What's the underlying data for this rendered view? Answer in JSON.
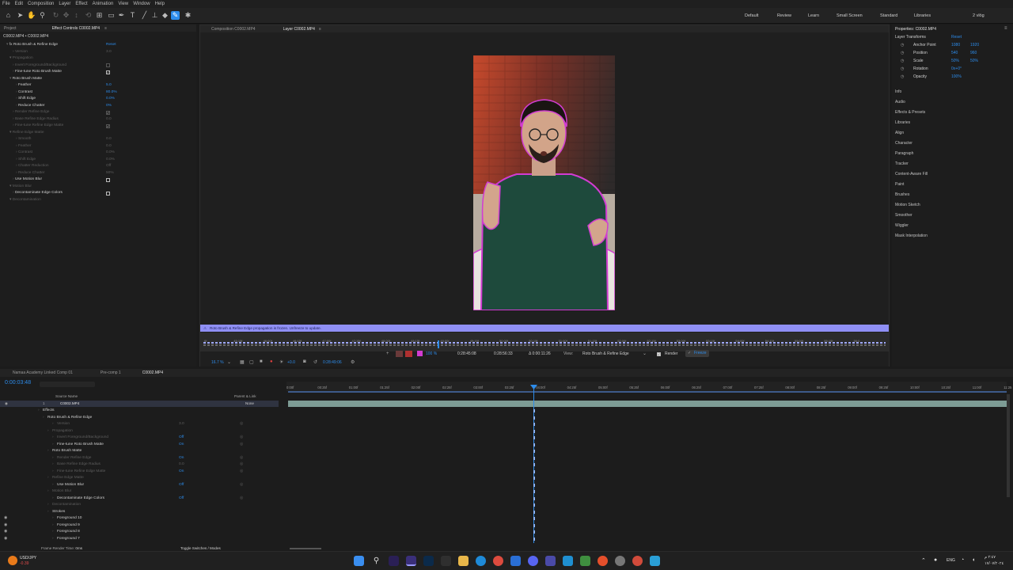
{
  "menu": [
    "File",
    "Edit",
    "Composition",
    "Layer",
    "Effect",
    "Animation",
    "View",
    "Window",
    "Help"
  ],
  "workspaces": [
    "Default",
    "Review",
    "Learn",
    "Small Screen",
    "Standard",
    "Libraries"
  ],
  "workspaces_extra": "2 vlög",
  "effect_panel": {
    "tabs": [
      "Project",
      "Effect Controls C0002.MP4"
    ],
    "header": "C0002.MP4 • C0002.MP4",
    "rows": [
      {
        "label": "fx  Roto Brush & Refine Edge",
        "value": "Reset",
        "indent": 1,
        "style": "wht",
        "vstyle": "blue"
      },
      {
        "label": "Version",
        "value": "3.0",
        "indent": 3,
        "style": "dim",
        "vstyle": "dim"
      },
      {
        "label": "Propagation",
        "value": "",
        "indent": 2,
        "style": "dim"
      },
      {
        "label": "Invert Foreground/Background",
        "value": "",
        "indent": 3,
        "style": "dim",
        "check": "off-dis"
      },
      {
        "label": "Fine-tune Roto Brush Matte",
        "value": "",
        "indent": 3,
        "style": "wht",
        "check": "on"
      },
      {
        "label": "Roto Brush Matte",
        "value": "",
        "indent": 2,
        "style": "wht"
      },
      {
        "label": "Feather",
        "value": "5.0",
        "indent": 4,
        "style": "wht",
        "vstyle": "blue"
      },
      {
        "label": "Contrast",
        "value": "80.0%",
        "indent": 4,
        "style": "wht",
        "vstyle": "blue"
      },
      {
        "label": "Shift Edge",
        "value": "0.0%",
        "indent": 4,
        "style": "wht",
        "vstyle": "blue"
      },
      {
        "label": "Reduce Chatter",
        "value": "0%",
        "indent": 4,
        "style": "wht",
        "vstyle": "blue"
      },
      {
        "label": "Render Refine Edge",
        "value": "",
        "indent": 3,
        "style": "dim",
        "check": "on-dis"
      },
      {
        "label": "Base Refine Edge Radius",
        "value": "0.0",
        "indent": 3,
        "style": "dim",
        "vstyle": "dim"
      },
      {
        "label": "Fine-tune Refine Edge Matte",
        "value": "",
        "indent": 3,
        "style": "dim",
        "check": "on-dis"
      },
      {
        "label": "Refine Edge Matte",
        "value": "",
        "indent": 2,
        "style": "dim"
      },
      {
        "label": "Smooth",
        "value": "0.0",
        "indent": 4,
        "style": "dim",
        "vstyle": "dim"
      },
      {
        "label": "Feather",
        "value": "0.0",
        "indent": 4,
        "style": "dim",
        "vstyle": "dim"
      },
      {
        "label": "Contrast",
        "value": "0.0%",
        "indent": 4,
        "style": "dim",
        "vstyle": "dim"
      },
      {
        "label": "Shift Edge",
        "value": "0.0%",
        "indent": 4,
        "style": "dim",
        "vstyle": "dim"
      },
      {
        "label": "Chatter Reduction",
        "value": "Off",
        "indent": 4,
        "style": "dim",
        "vstyle": "dim"
      },
      {
        "label": "Reduce Chatter",
        "value": "50%",
        "indent": 4,
        "style": "dim",
        "vstyle": "dim"
      },
      {
        "label": "Use Motion Blur",
        "value": "",
        "indent": 3,
        "style": "wht",
        "check": "off"
      },
      {
        "label": "Motion Blur",
        "value": "",
        "indent": 2,
        "style": "dim"
      },
      {
        "label": "Decontaminate Edge Colors",
        "value": "",
        "indent": 3,
        "style": "wht",
        "check": "off"
      },
      {
        "label": "Decontamination",
        "value": "",
        "indent": 2,
        "style": "dim"
      }
    ]
  },
  "viewer": {
    "tabs": [
      "Composition C0002.MP4",
      "Layer C0002.MP4"
    ],
    "status_bar": "Roto Brush & Refine Edge propagation is frozen. Unfreeze to update.",
    "ruler_ticks": [
      "0f",
      "45:15f",
      "46:00f",
      "46:15f",
      "47:00f",
      "47:15f",
      "48:00f",
      "48:15f",
      "49:00f",
      "49:15f",
      "50:00f",
      "50:15f",
      "51:00f",
      "51:15f",
      "52:00f",
      "52:15f",
      "53:00f",
      "53:15f",
      "54:00f",
      "54:15f",
      "55:00f",
      "55:15f",
      "56:0"
    ],
    "zoom": "16.7 %",
    "exposure": "+0.0",
    "timecode": "0:28:49:06",
    "in_point": "0:28:45:08",
    "out_point": "0:28:56:33",
    "duration": "Δ 0:00:11:26",
    "view_label": "View:",
    "view_value": "Roto Brush & Refine Edge",
    "render_label": "Render",
    "freeze_label": "Freeze",
    "mag": "100 %"
  },
  "properties": {
    "title": "Properties: C0002.MP4",
    "section": "Layer Transforms",
    "reset": "Reset",
    "rows": [
      {
        "label": "Anchor Point",
        "v1": "1080",
        "v2": "1920"
      },
      {
        "label": "Position",
        "v1": "540",
        "v2": "960"
      },
      {
        "label": "Scale",
        "v1": "50%",
        "v2": "50%"
      },
      {
        "label": "Rotation",
        "v1": "0x+0°",
        "v2": ""
      },
      {
        "label": "Opacity",
        "v1": "100%",
        "v2": ""
      }
    ],
    "panels": [
      "Info",
      "Audio",
      "Effects & Presets",
      "Libraries",
      "Align",
      "Character",
      "Paragraph",
      "Tracker",
      "Content-Aware Fill",
      "Paint",
      "Brushes",
      "Motion Sketch",
      "Smoother",
      "Wiggler",
      "Mask Interpolation"
    ]
  },
  "timeline": {
    "tabs": [
      "Namaa Academy Linked Comp 01",
      "Pre-comp 1",
      "C0002.MP4"
    ],
    "timecode": "0:00:03:48",
    "col_source": "Source Name",
    "col_parent": "Parent & Link",
    "layer": {
      "num": "1",
      "name": "C0002.MP4",
      "parent": "None"
    },
    "rows": [
      {
        "label": "Effects",
        "indent": 1,
        "style": "wht",
        "val": ""
      },
      {
        "label": "Roto Brush & Refine Edge",
        "indent": 2,
        "style": "wht",
        "val": ""
      },
      {
        "label": "Version",
        "indent": 4,
        "style": "dim",
        "val": "3.0"
      },
      {
        "label": "Propagation",
        "indent": 3,
        "style": "dim",
        "val": ""
      },
      {
        "label": "Invert Foreground/Background",
        "indent": 4,
        "style": "dim",
        "val": "Off"
      },
      {
        "label": "Fine-tune Roto Brush Matte",
        "indent": 4,
        "style": "wht",
        "val": "On"
      },
      {
        "label": "Roto Brush Matte",
        "indent": 3,
        "style": "wht",
        "val": ""
      },
      {
        "label": "Render Refine Edge",
        "indent": 4,
        "style": "dim",
        "val": "On"
      },
      {
        "label": "Base Refine Edge Radius",
        "indent": 4,
        "style": "dim",
        "val": "0.0"
      },
      {
        "label": "Fine-tune Refine Edge Matte",
        "indent": 4,
        "style": "dim",
        "val": "On"
      },
      {
        "label": "Refine Edge Matte",
        "indent": 3,
        "style": "dim",
        "val": ""
      },
      {
        "label": "Use Motion Blur",
        "indent": 4,
        "style": "wht",
        "val": "Off"
      },
      {
        "label": "Motion Blur",
        "indent": 3,
        "style": "dim",
        "val": ""
      },
      {
        "label": "Decontaminate Edge Colors",
        "indent": 4,
        "style": "wht",
        "val": "Off"
      },
      {
        "label": "Decontamination",
        "indent": 3,
        "style": "dim",
        "val": ""
      },
      {
        "label": "Strokes",
        "indent": 3,
        "style": "wht",
        "val": ""
      },
      {
        "label": "Foreground 10",
        "indent": 4,
        "style": "wht",
        "val": ""
      },
      {
        "label": "Foreground 9",
        "indent": 4,
        "style": "wht",
        "val": ""
      },
      {
        "label": "Foreground 8",
        "indent": 4,
        "style": "wht",
        "val": ""
      },
      {
        "label": "Foreground 7",
        "indent": 4,
        "style": "wht",
        "val": ""
      }
    ],
    "ruler": [
      "0:00f",
      "00:25f",
      "01:00f",
      "01:25f",
      "02:00f",
      "02:25f",
      "03:00f",
      "03:25f",
      "04:00f",
      "04:25f",
      "05:00f",
      "05:25f",
      "06:00f",
      "06:25f",
      "07:00f",
      "07:25f",
      "08:00f",
      "08:25f",
      "09:00f",
      "09:25f",
      "10:00f",
      "10:25f",
      "11:00f",
      "11:25"
    ],
    "frame_render": "Frame Render Time:",
    "frame_render_val": "0ms",
    "toggle": "Toggle Switches / Modes"
  },
  "taskbar": {
    "ticker": "USD/JPY",
    "ticker_val": "-0.39",
    "lang": "ENG",
    "time": "‏٢:٤٧ م",
    "date": "١٧/٠٧/٢٠٢٤"
  },
  "colors": {
    "accent": "#2d8ceb",
    "status": "#8f8ff5",
    "magenta": "#d23cd2"
  }
}
